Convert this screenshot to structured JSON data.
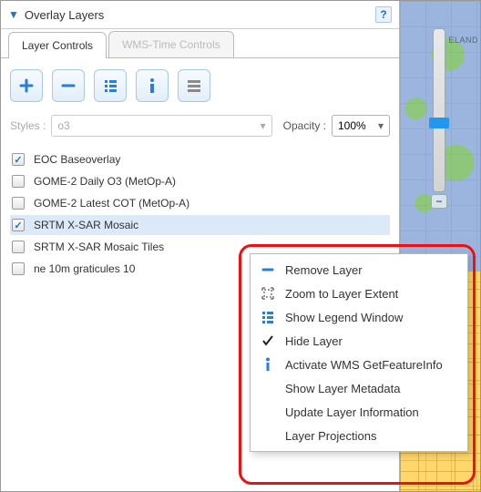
{
  "panel": {
    "title": "Overlay Layers",
    "help": "?"
  },
  "tabs": [
    {
      "label": "Layer Controls",
      "active": true
    },
    {
      "label": "WMS-Time Controls",
      "disabled": true
    }
  ],
  "toolbar_icons": [
    "plus",
    "minus",
    "list",
    "info",
    "lines"
  ],
  "styles": {
    "label": "Styles :",
    "value": "o3"
  },
  "opacity": {
    "label": "Opacity :",
    "value": "100%"
  },
  "layers": [
    {
      "label": "EOC Baseoverlay",
      "checked": true,
      "selected": false
    },
    {
      "label": "GOME-2 Daily O3 (MetOp-A)",
      "checked": false,
      "selected": false
    },
    {
      "label": "GOME-2 Latest COT (MetOp-A)",
      "checked": false,
      "selected": false
    },
    {
      "label": "SRTM X-SAR Mosaic",
      "checked": true,
      "selected": true
    },
    {
      "label": "SRTM X-SAR Mosaic Tiles",
      "checked": false,
      "selected": false
    },
    {
      "label": "ne 10m graticules 10",
      "checked": false,
      "selected": false
    }
  ],
  "context_menu": [
    {
      "icon": "minus",
      "label": "Remove Layer"
    },
    {
      "icon": "extent",
      "label": "Zoom to Layer Extent"
    },
    {
      "icon": "list",
      "label": "Show Legend Window"
    },
    {
      "icon": "check",
      "label": "Hide Layer"
    },
    {
      "icon": "info",
      "label": "Activate WMS GetFeatureInfo"
    },
    {
      "icon": "",
      "label": "Show Layer Metadata"
    },
    {
      "icon": "",
      "label": "Update Layer Information"
    },
    {
      "icon": "",
      "label": "Layer Projections"
    }
  ],
  "map_label": "ELAND",
  "slider_minus": "−"
}
